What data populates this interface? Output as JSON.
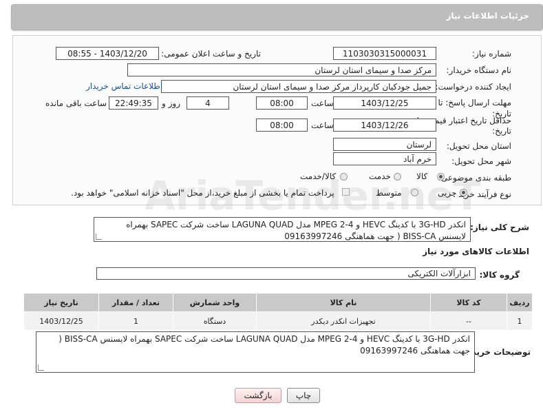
{
  "header": {
    "title": "جزئیات اطلاعات نیاز"
  },
  "form": {
    "need_number_label": "شماره نیاز:",
    "need_number": "1103030315000031",
    "announce_label": "تاریخ و ساعت اعلان عمومی:",
    "announce_value": "1403/12/20 - 08:55",
    "buyer_org_label": "نام دستگاه خریدار:",
    "buyer_org": "مرکز صدا و سیمای استان لرستان",
    "creator_label": "ایجاد کننده درخواست:",
    "creator": "جمیل جودکیان کارپرداز مرکز صدا و سیمای استان لرستان",
    "contact_link": "اطلاعات تماس خریدار",
    "deadline_label_1": "مهلت ارسال پاسخ: تا",
    "deadline_label_2": "تاریخ:",
    "deadline_date": "1403/12/25",
    "time_label": "ساعت",
    "deadline_time": "08:00",
    "days_value": "4",
    "days_label": "روز و",
    "remaining_time": "22:49:35",
    "remaining_label": "ساعت باقی مانده",
    "validity_label_1": "حداقل تاریخ اعتبار قیمت: تا",
    "validity_label_2": "تاریخ:",
    "validity_date": "1403/12/26",
    "validity_time": "08:00",
    "province_label": "استان محل تحویل:",
    "province": "لرستان",
    "city_label": "شهر محل تحویل:",
    "city": "خرم آباد",
    "category_label": "طبقه بندی موضوعی:",
    "category_options": [
      "کالا",
      "خدمت",
      "کالا/خدمت"
    ],
    "category_selected": "کالا",
    "process_label": "نوع فرآیند خرید :",
    "process_options": [
      "جزیی",
      "متوسط"
    ],
    "process_selected": "جزیی",
    "treasury_note": "پرداخت تمام یا بخشی از مبلغ خرید،از محل \"اسناد خزانه اسلامی\" خواهد بود."
  },
  "summary": {
    "label": "شرح کلی نیاز:",
    "text": "انکدر 3G-HD با کدینگ HEVC و MPEG 2-4 مدل LAGUNA QUAD ساخت شرکت SAPEC بهمراه لایسنس BISS-CA  ( جهت هماهنگی   09163997246"
  },
  "goods": {
    "section_title": "اطلاعات کالاهای مورد نیاز",
    "group_label": "گروه کالا:",
    "group_value": "ابزارآلات الکتریکی",
    "columns": [
      "ردیف",
      "کد کالا",
      "نام کالا",
      "واحد شمارش",
      "تعداد / مقدار",
      "تاریخ نیاز"
    ],
    "rows": [
      [
        "1",
        "--",
        "تجهیزات انکدر دیکدر",
        "دستگاه",
        "1",
        "1403/12/25"
      ]
    ]
  },
  "buyer_notes": {
    "label": "توضیحات خریدار:",
    "text": "انکدر 3G-HD با کدینگ HEVC و MPEG 2-4 مدل LAGUNA QUAD ساخت شرکت SAPEC بهمراه لایسنس BISS-CA  ( جهت هماهنگی   09163997246"
  },
  "buttons": {
    "print": "چاپ",
    "back": "بازگشت"
  },
  "watermark": "AriaTender.neT"
}
